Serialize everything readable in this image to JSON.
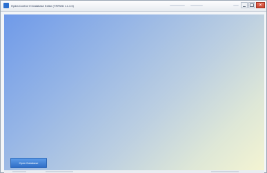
{
  "window": {
    "title": "Hydra Control VI Database Editor (YRRWD v.1.3.0)"
  },
  "main": {
    "open_database_label": "Open Database"
  }
}
